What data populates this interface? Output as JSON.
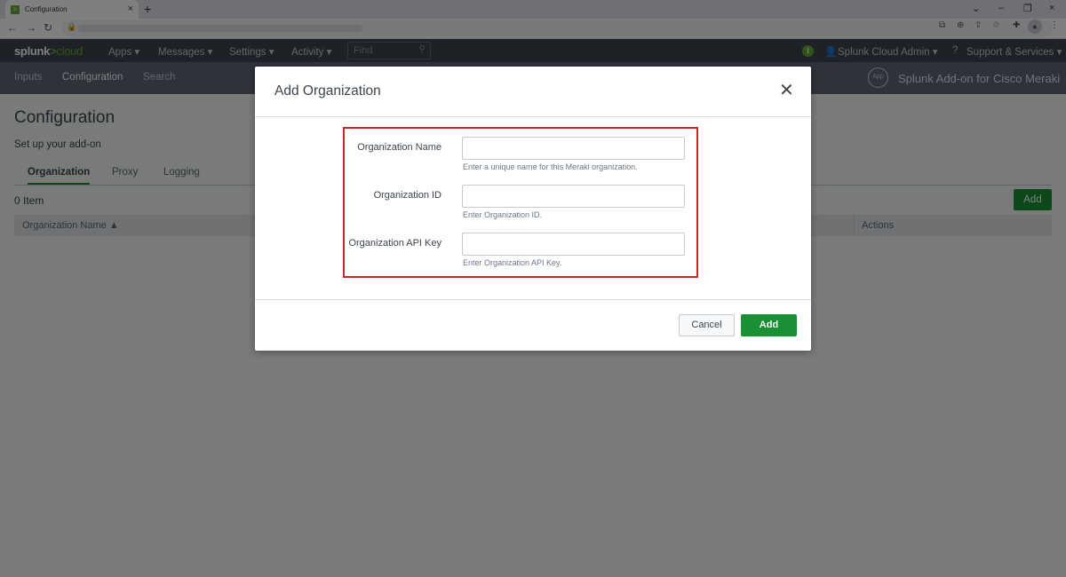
{
  "browser": {
    "tab_title": "Configuration",
    "tab_favicon": ">",
    "new_tab": "+",
    "tab_close": "×",
    "window_controls": [
      "⌄",
      "–",
      "❐",
      "×"
    ]
  },
  "splunk_bar": {
    "logo_prefix": "splunk",
    "logo_gt": ">",
    "logo_suffix": "cloud",
    "menus": [
      "Apps ▾",
      "Messages ▾",
      "Settings ▾",
      "Activity ▾"
    ],
    "find_placeholder": "Find",
    "status_icon": "i",
    "user_menu": "Splunk Cloud Admin ▾",
    "support_menu": "Support & Services ▾"
  },
  "app_bar": {
    "nav": [
      "Inputs",
      "Configuration",
      "Search"
    ],
    "active_nav": "Configuration",
    "app_badge": "App",
    "app_title": "Splunk Add-on for Cisco Meraki"
  },
  "page": {
    "title": "Configuration",
    "subtitle": "Set up your add-on",
    "tabs": [
      "Organization",
      "Proxy",
      "Logging"
    ],
    "active_tab": "Organization",
    "item_count": "0 Item",
    "add_button": "Add",
    "table_headers": [
      "Organization Name ▲",
      "Actions"
    ]
  },
  "modal": {
    "title": "Add Organization",
    "close": "✕",
    "fields": [
      {
        "label": "Organization Name",
        "value": "",
        "help": "Enter a unique name for this Meraki organization."
      },
      {
        "label": "Organization ID",
        "value": "",
        "help": "Enter Organization ID."
      },
      {
        "label": "Organization API Key",
        "value": "",
        "help": "Enter Organization API Key."
      }
    ],
    "cancel_label": "Cancel",
    "add_label": "Add"
  },
  "colors": {
    "accent_green": "#1a9035",
    "highlight_red": "#c62828",
    "splunk_bar": "#3c444d",
    "app_bar": "#5c6773"
  }
}
